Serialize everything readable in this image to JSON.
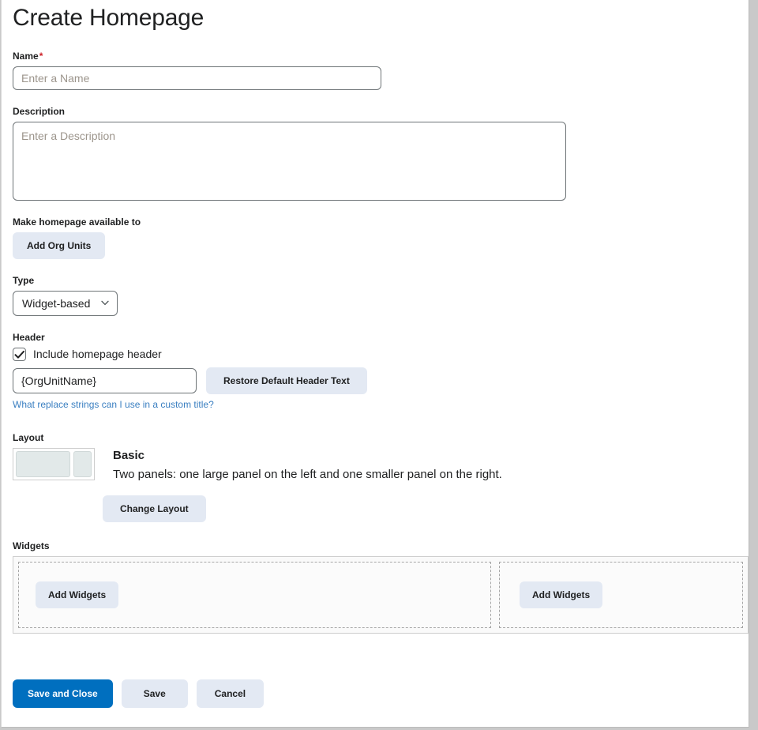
{
  "page": {
    "title": "Create Homepage"
  },
  "name_field": {
    "label": "Name",
    "required_marker": "*",
    "placeholder": "Enter a Name",
    "value": ""
  },
  "description_field": {
    "label": "Description",
    "placeholder": "Enter a Description",
    "value": ""
  },
  "org_units": {
    "label": "Make homepage available to",
    "button_label": "Add Org Units"
  },
  "type_field": {
    "label": "Type",
    "selected": "Widget-based",
    "options": [
      "Widget-based"
    ],
    "icon": "chevron-down-icon"
  },
  "header_section": {
    "label": "Header",
    "checkbox_label": "Include homepage header",
    "checkbox_checked": true,
    "header_text_value": "{OrgUnitName}",
    "restore_button_label": "Restore Default Header Text",
    "help_link_text": "What replace strings can I use in a custom title?",
    "link_color": "#3a7fc1"
  },
  "layout_section": {
    "label": "Layout",
    "layout_name": "Basic",
    "layout_description": "Two panels: one large panel on the left and one smaller panel on the right.",
    "change_button_label": "Change Layout"
  },
  "widgets_section": {
    "label": "Widgets",
    "zones": [
      {
        "add_label": "Add Widgets"
      },
      {
        "add_label": "Add Widgets"
      }
    ]
  },
  "footer": {
    "save_and_close_label": "Save and Close",
    "save_label": "Save",
    "cancel_label": "Cancel",
    "primary_color": "#006fbf",
    "secondary_color": "#e3e9f3"
  }
}
